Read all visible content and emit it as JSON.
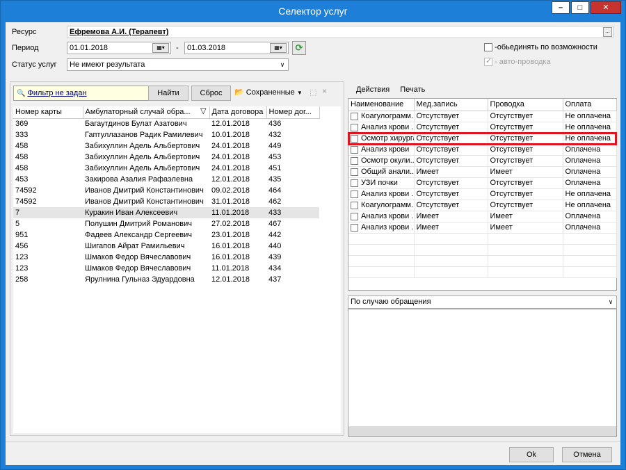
{
  "window": {
    "title": "Селектор услуг",
    "minimize": "–",
    "maximize": "□",
    "close": "✕"
  },
  "form": {
    "resource_label": "Ресурс",
    "resource_value": "Ефремова А.И. (Терапевт)",
    "resource_btn": "...",
    "period_label": "Период",
    "date_from": "01.01.2018",
    "date_sep": "-",
    "date_to": "01.03.2018",
    "status_label": "Статус услуг",
    "status_value": "Не имеют результата",
    "merge_label": "-обьединять по возможности",
    "autopost_label": "- авто-проводка"
  },
  "toolbar": {
    "filter_label": "Фильтр не задан",
    "find_label": "Найти",
    "reset_label": "Сброс",
    "saved_label": "Сохраненные"
  },
  "cases": {
    "columns": [
      "Номер карты",
      "Амбулаторный случай обра...",
      "Дата договора",
      "Номер дог..."
    ],
    "rows": [
      [
        "369",
        "Багаутдинов Булат Азатович",
        "12.01.2018",
        "436"
      ],
      [
        "333",
        "Гаптуллазанов Радик Рамилевич",
        "10.01.2018",
        "432"
      ],
      [
        "458",
        "Забихуллин Адель Альбертович",
        "24.01.2018",
        "449"
      ],
      [
        "458",
        "Забихуллин Адель Альбертович",
        "24.01.2018",
        "453"
      ],
      [
        "458",
        "Забихуллин Адель Альбертович",
        "24.01.2018",
        "451"
      ],
      [
        "453",
        "Закирова Азалия Рафаэлевна",
        "12.01.2018",
        "435"
      ],
      [
        "74592",
        "Иванов Дмитрий Константинович",
        "09.02.2018",
        "464"
      ],
      [
        "74592",
        "Иванов Дмитрий Константинович",
        "31.01.2018",
        "462"
      ],
      [
        "7",
        "Куракин Иван Алексеевич",
        "11.01.2018",
        "433"
      ],
      [
        "5",
        "Полушин Дмитрий Романович",
        "27.02.2018",
        "467"
      ],
      [
        "951",
        "Фадеев Александр Сергеевич",
        "23.01.2018",
        "442"
      ],
      [
        "456",
        "Шигапов Айрат Рамильевич",
        "16.01.2018",
        "440"
      ],
      [
        "123",
        "Шмаков Федор Вячеславович",
        "16.01.2018",
        "439"
      ],
      [
        "123",
        "Шмаков Федор Вячеславович",
        "11.01.2018",
        "434"
      ],
      [
        "258",
        "Ярулнина Гульназ Эдуардовна",
        "12.01.2018",
        "437"
      ]
    ]
  },
  "services_menu": {
    "actions": "Действия",
    "print": "Печать"
  },
  "services": {
    "columns": [
      "Наименование",
      "Мед.запись",
      "Проводка",
      "Оплата"
    ],
    "rows": [
      [
        "Коагулограмм...",
        "Отсутствует",
        "Отсутствует",
        "Не оплачена"
      ],
      [
        "Анализ крови ...",
        "Отсутствует",
        "Отсутствует",
        "Не оплачена"
      ],
      [
        "Осмотр хирурга",
        "Отсутствует",
        "Отсутствует",
        "Не оплачена"
      ],
      [
        "Анализ крови",
        "Отсутствует",
        "Отсутствует",
        "Оплачена"
      ],
      [
        "Осмотр окули...",
        "Отсутствует",
        "Отсутствует",
        "Оплачена"
      ],
      [
        "Общий анали...",
        "Имеет",
        "Имеет",
        "Оплачена"
      ],
      [
        "УЗИ почки",
        "Отсутствует",
        "Отсутствует",
        "Оплачена"
      ],
      [
        "Анализ крови ...",
        "Отсутствует",
        "Отсутствует",
        "Не оплачена"
      ],
      [
        "Коагулограмм...",
        "Отсутствует",
        "Отсутствует",
        "Не оплачена"
      ],
      [
        "Анализ крови ...",
        "Имеет",
        "Имеет",
        "Оплачена"
      ],
      [
        "Анализ крови ...",
        "Имеет",
        "Имеет",
        "Оплачена"
      ]
    ]
  },
  "grouping": {
    "value": "По случаю обращения"
  },
  "footer": {
    "ok_label": "Ok",
    "cancel_label": "Отмена"
  }
}
